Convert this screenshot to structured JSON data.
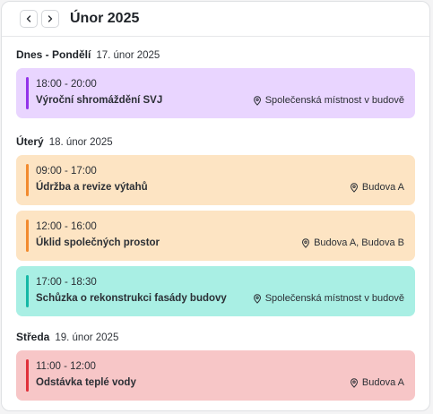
{
  "header": {
    "prev_icon": "chevron-left-icon",
    "next_icon": "chevron-right-icon",
    "month_title": "Únor 2025"
  },
  "days": [
    {
      "name": "Dnes - Pondělí",
      "date": "17. únor 2025",
      "events": [
        {
          "time": "18:00 - 20:00",
          "title": "Výroční shromáždění SVJ",
          "location": "Společenská místnost v budově",
          "color": "purple"
        }
      ]
    },
    {
      "name": "Úterý",
      "date": "18. únor 2025",
      "events": [
        {
          "time": "09:00 - 17:00",
          "title": "Údržba a revize výtahů",
          "location": "Budova A",
          "color": "orange"
        },
        {
          "time": "12:00 - 16:00",
          "title": "Úklid společných prostor",
          "location": "Budova A, Budova B",
          "color": "orange"
        },
        {
          "time": "17:00 - 18:30",
          "title": "Schůzka o rekonstrukci fasády budovy",
          "location": "Společenská místnost v budově",
          "color": "teal"
        }
      ]
    },
    {
      "name": "Středa",
      "date": "19. únor 2025",
      "events": [
        {
          "time": "11:00 - 12:00",
          "title": "Odstávka teplé vody",
          "location": "Budova A",
          "color": "red"
        }
      ]
    }
  ],
  "colors": {
    "purple": "#e9d5ff",
    "orange": "#fde4c3",
    "teal": "#a9efe4",
    "red": "#f7c6c7"
  }
}
